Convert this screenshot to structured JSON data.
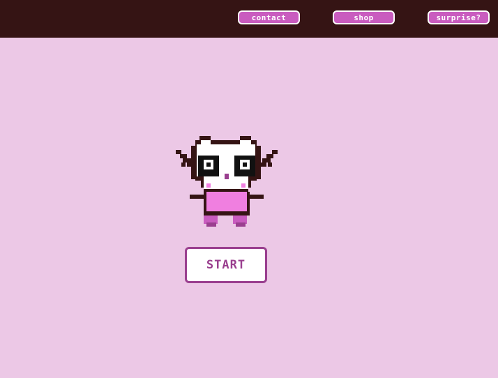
{
  "nav": {
    "items": [
      {
        "label": "contact"
      },
      {
        "label": "shop"
      },
      {
        "label": "surprise?"
      }
    ]
  },
  "main": {
    "mascot_icon": "pixel-cat-icon",
    "start_label": "START"
  },
  "colors": {
    "background": "#ecc8e6",
    "topbar": "#351414",
    "nav_button": "#c95cbf",
    "start_border": "#9a3f8f",
    "dress": "#f07fe0"
  }
}
